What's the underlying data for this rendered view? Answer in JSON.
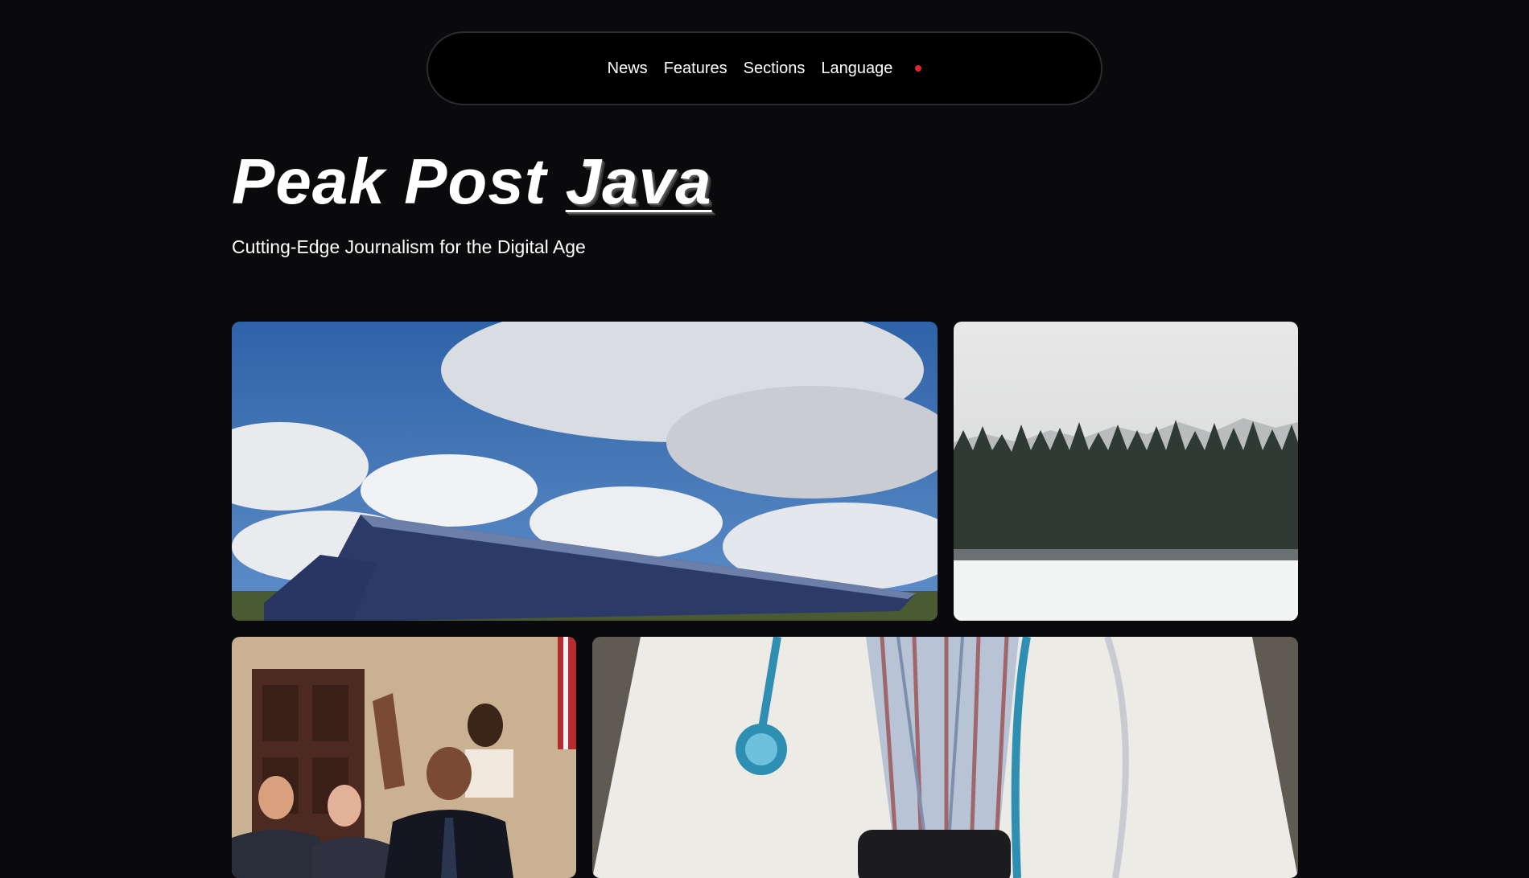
{
  "nav": {
    "items": [
      {
        "label": "News"
      },
      {
        "label": "Features"
      },
      {
        "label": "Sections"
      },
      {
        "label": "Language"
      }
    ],
    "indicator_color": "#e8232f"
  },
  "masthead": {
    "title_main": "Peak Post",
    "title_accent": "Java",
    "tagline": "Cutting-Edge Journalism for the Digital Age"
  },
  "colors": {
    "background": "#0a0a0d",
    "nav_background": "#000000",
    "text": "#ffffff"
  },
  "stories": [
    {
      "image": "solar-panels-under-cloudy-sky"
    },
    {
      "image": "snowy-forest-lake"
    },
    {
      "image": "politician-on-phone-waving-crowd"
    },
    {
      "image": "doctor-with-stethoscope-and-phone"
    }
  ]
}
